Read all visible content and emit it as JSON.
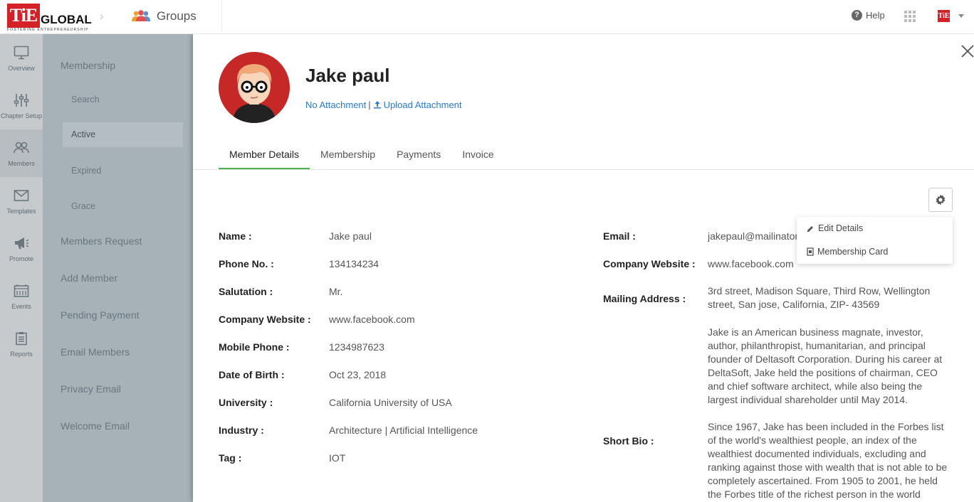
{
  "header": {
    "logo_text": "TiE",
    "logo_global": "GLOBAL",
    "logo_tagline": "FOSTERING ENTREPRENEURSHIP",
    "breadcrumb_title": "Groups",
    "help_label": "Help",
    "user_badge": "TiE"
  },
  "iconbar": {
    "items": [
      {
        "label": "Overview",
        "icon": "monitor-icon"
      },
      {
        "label": "Chapter Setup",
        "icon": "sliders-icon"
      },
      {
        "label": "Members",
        "icon": "members-icon",
        "active": true
      },
      {
        "label": "Templates",
        "icon": "envelope-icon"
      },
      {
        "label": "Promote",
        "icon": "megaphone-icon"
      },
      {
        "label": "Events",
        "icon": "calendar-icon"
      },
      {
        "label": "Reports",
        "icon": "clipboard-icon"
      }
    ]
  },
  "submenu": {
    "membership": "Membership",
    "search": "Search",
    "active": "Active",
    "expired": "Expired",
    "grace": "Grace",
    "members_request": "Members Request",
    "add_member": "Add Member",
    "pending_payment": "Pending Payment",
    "email_members": "Email Members",
    "privacy_email": "Privacy Email",
    "welcome_email": "Welcome Email"
  },
  "profile": {
    "name": "Jake paul",
    "no_attachment": "No Attachment",
    "separator": "|",
    "upload_attachment": "Upload Attachment"
  },
  "tabs": [
    "Member Details",
    "Membership",
    "Payments",
    "Invoice"
  ],
  "actions_menu": {
    "edit_details": "Edit Details",
    "membership_card": "Membership Card"
  },
  "details_left": [
    {
      "label": "Name :",
      "value": "Jake paul"
    },
    {
      "label": "Phone No. :",
      "value": "134134234"
    },
    {
      "label": "Salutation :",
      "value": "Mr."
    },
    {
      "label": "Company Website :",
      "value": "www.facebook.com"
    },
    {
      "label": "Mobile Phone :",
      "value": "1234987623"
    },
    {
      "label": "Date of Birth :",
      "value": "Oct 23, 2018"
    },
    {
      "label": "University :",
      "value": "California University of USA"
    },
    {
      "label": "Industry :",
      "value": "Architecture | Artificial Intelligence"
    },
    {
      "label": "Tag :",
      "value": "IOT"
    }
  ],
  "details_right": {
    "email_label": "Email :",
    "email_value": "jakepaul@mailinator.com",
    "website_label": "Company Website :",
    "website_value": "www.facebook.com",
    "mailing_label": "Mailing Address :",
    "mailing_value": "3rd street, Madison Square, Third Row, Wellington street, San jose, California, ZIP- 43569",
    "bio_para1": "Jake is an American business magnate, investor, author, philanthropist, humanitarian, and principal founder of Deltasoft Corporation. During his career at DeltaSoft, Jake held the positions of chairman, CEO and chief software architect, while also being the largest individual shareholder until May 2014.",
    "short_bio_label": "Short Bio :",
    "bio_para2": "Since 1967, Jake has been included in the Forbes list of the world's wealthiest people, an index of the wealthiest documented individuals, excluding and ranking against those with wealth that is not able to be completely ascertained. From 1905 to 2001, he held the Forbes title of the richest person in the world"
  },
  "colors": {
    "brand_red": "#d42027",
    "link_blue": "#2a7bd0",
    "tab_active": "#4caf50",
    "iconbar_bg": "#c6cacd",
    "submenu_bg": "#a6b1b8"
  }
}
